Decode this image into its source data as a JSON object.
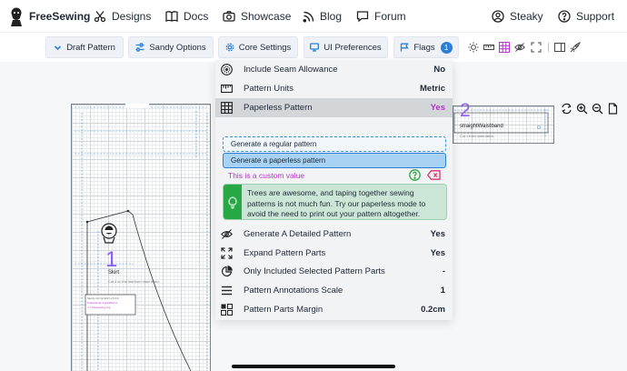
{
  "nav": {
    "brand": "FreeSewing",
    "items": [
      {
        "label": "Designs",
        "icon": "scissors-icon"
      },
      {
        "label": "Docs",
        "icon": "book-icon"
      },
      {
        "label": "Showcase",
        "icon": "camera-icon"
      },
      {
        "label": "Blog",
        "icon": "rss-icon"
      },
      {
        "label": "Forum",
        "icon": "chat-icon"
      }
    ],
    "user": "Steaky",
    "support": "Support"
  },
  "toolbar": {
    "draft": "Draft Pattern",
    "options": "Sandy Options",
    "core": "Core Settings",
    "ui": "UI Preferences",
    "flags": "Flags",
    "flags_count": "1"
  },
  "panel": {
    "rows_top": [
      {
        "label": "Include Seam Allowance",
        "value": "No",
        "icon": "seam-allowance-icon"
      },
      {
        "label": "Pattern Units",
        "value": "Metric",
        "icon": "ruler-icon"
      },
      {
        "label": "Paperless Pattern",
        "value": "Yes",
        "icon": "grid-icon"
      }
    ],
    "paperless_options": [
      "Generate a regular pattern",
      "Generate a paperless pattern"
    ],
    "custom_value": "This is a custom value",
    "tip": "Trees are awesome, and taping together sewing patterns is not much fun. Try our paperless mode to avoid the need to print out your pattern altogether.",
    "rows_bottom": [
      {
        "label": "Generate A Detailed Pattern",
        "value": "Yes",
        "icon": "eye-slash-icon"
      },
      {
        "label": "Expand Pattern Parts",
        "value": "Yes",
        "icon": "expand-icon"
      },
      {
        "label": "Only Included Selected Pattern Parts",
        "value": "-",
        "icon": "pie-icon"
      },
      {
        "label": "Pattern Annotations Scale",
        "value": "1",
        "icon": "lines-icon"
      },
      {
        "label": "Pattern Parts Margin",
        "value": "0.2cm",
        "icon": "margin-icon"
      }
    ]
  },
  "pattern": {
    "part1_number": "1",
    "part1_name": "Skirt",
    "part1_instr": "Cut 4 on the fold from main fabric",
    "part2_number": "2",
    "part2_name": "straightWaistband",
    "part2_instr": "Cut 1 from main fabric"
  },
  "colors": {
    "accent": "#2c7fd6",
    "active_value": "#b534c9",
    "tip_bar": "#28a745"
  }
}
